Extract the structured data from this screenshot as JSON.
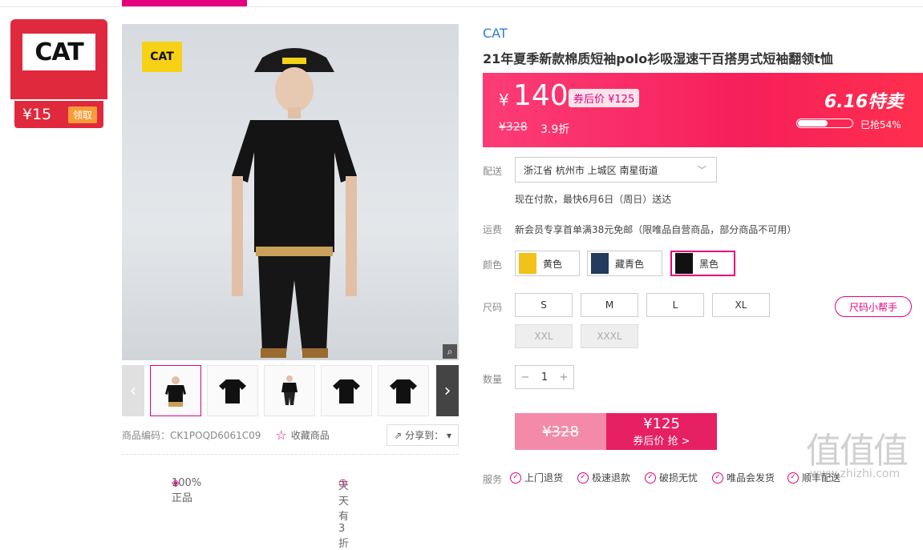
{
  "coupon": {
    "logo_text": "CAT",
    "price": "¥15",
    "claim": "领取"
  },
  "gallery": {
    "badge_text": "CAT",
    "zoom_icon": "magnifier-icon",
    "prev_icon": "chevron-left",
    "next_icon": "chevron-right"
  },
  "meta": {
    "sku": "商品编码：CK1POQD6061C09",
    "favorite": "收藏商品",
    "share": "分享到："
  },
  "footer": {
    "genuine": "100%正品",
    "daily": "天天有3折"
  },
  "product": {
    "brand": "CAT",
    "title": "21年夏季新款棉质短袖polo衫吸湿速干百搭男式短袖翻领t恤",
    "currency": "¥",
    "price": "140",
    "coupon_price": "券后价 ¥125",
    "original_price": "¥328",
    "discount": "3.9折",
    "sale_label": "6.16特卖",
    "sold_text": "已抢54%",
    "sold_fraction": 0.54
  },
  "delivery": {
    "label": "配送",
    "address": "浙江省 杭州市 上城区 南星街道",
    "eta": "现在付款，最快6月6日（周日）送达"
  },
  "shipping": {
    "label": "运费",
    "text": "新会员专享首单满38元免邮（限唯品自营商品，部分商品不可用）"
  },
  "colors": {
    "label": "颜色",
    "options": [
      {
        "name": "黄色",
        "color": "#f2c21a"
      },
      {
        "name": "藏青色",
        "color": "#243a5e"
      },
      {
        "name": "黑色",
        "color": "#111111",
        "selected": true
      }
    ]
  },
  "sizes": {
    "label": "尺码",
    "options": [
      {
        "name": "S"
      },
      {
        "name": "M"
      },
      {
        "name": "L"
      },
      {
        "name": "XL"
      },
      {
        "name": "XXL",
        "disabled": true
      },
      {
        "name": "XXXL",
        "disabled": true
      }
    ],
    "helper": "尺码小帮手"
  },
  "quantity": {
    "label": "数量",
    "value": "1",
    "minus": "−",
    "plus": "+"
  },
  "buy": {
    "original": "¥328",
    "price": "¥125",
    "action": "券后价 抢 >"
  },
  "service": {
    "label": "服务",
    "items": [
      "上门退货",
      "极速退款",
      "破损无忧",
      "唯品会发货",
      "顺丰配送"
    ]
  },
  "watermark": {
    "logo": "值值值",
    "url": "www.zhizhi.com"
  }
}
